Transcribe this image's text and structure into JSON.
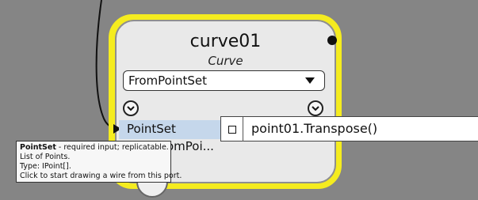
{
  "node": {
    "title": "curve01",
    "subtitle": "Curve",
    "method_selected": "FromPointSet",
    "input_port_label": "PointSet",
    "input_port2_label": "omPoi..."
  },
  "code_block": {
    "text": "point01.Transpose()"
  },
  "tooltip": {
    "name": "PointSet",
    "desc": " - required input; replicatable.",
    "line2": "List of Points.",
    "line3": "Type: IPoint[].",
    "line4": "Click to start drawing a wire from this port."
  },
  "colors": {
    "canvas": "#858585",
    "selection": "#f5ec1f",
    "node_body": "#e9e9e9",
    "port_highlight": "#c5d7eb"
  }
}
